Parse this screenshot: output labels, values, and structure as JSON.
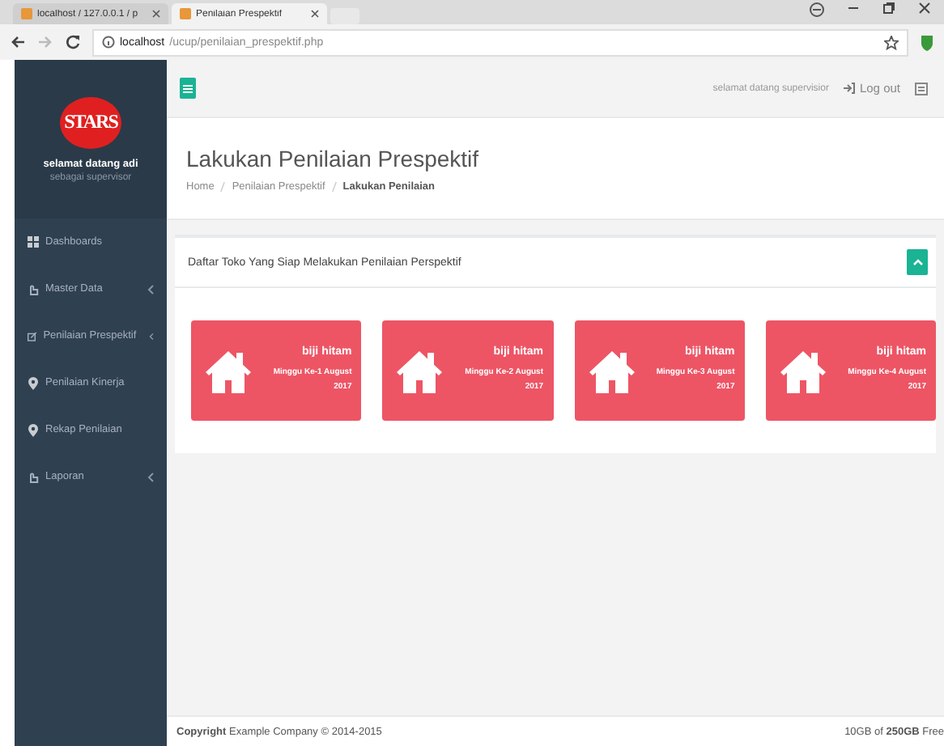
{
  "browser": {
    "tabs": [
      {
        "title": "localhost / 127.0.0.1 / p",
        "selected": false
      },
      {
        "title": "Penilaian Prespektif",
        "selected": true
      }
    ],
    "address": {
      "host": "localhost",
      "path": "/ucup/penilaian_prespektif.php"
    }
  },
  "sidebar": {
    "logo": "STARS",
    "welcome": "selamat datang adi",
    "role": "sebagai supervisor",
    "items": [
      {
        "label": "Dashboards",
        "kind": "grid",
        "has_submenu": false
      },
      {
        "label": "Master Data",
        "kind": "hand",
        "has_submenu": true
      },
      {
        "label": "Penilaian Prespektif",
        "kind": "edit",
        "has_submenu": true
      },
      {
        "label": "Penilaian Kinerja",
        "kind": "pin",
        "has_submenu": false
      },
      {
        "label": "Rekap Penilaian",
        "kind": "pin",
        "has_submenu": false
      },
      {
        "label": "Laporan",
        "kind": "hand",
        "has_submenu": true
      }
    ]
  },
  "topbar": {
    "greeting": "selamat datang supervisior",
    "logout": "Log out"
  },
  "heading": {
    "title": "Lakukan Penilaian Prespektif",
    "breadcrumbs": [
      {
        "label": "Home",
        "current": false
      },
      {
        "label": "Penilaian Prespektif",
        "current": false
      },
      {
        "label": "Lakukan Penilaian",
        "current": true
      }
    ]
  },
  "panel": {
    "title": "Daftar Toko Yang Siap Melakukan Penilaian Perspektif",
    "cards": [
      {
        "name": "biji hitam",
        "period": "Minggu Ke-1 August",
        "year": "2017"
      },
      {
        "name": "biji hitam",
        "period": "Minggu Ke-2 August",
        "year": "2017"
      },
      {
        "name": "biji hitam",
        "period": "Minggu Ke-3 August",
        "year": "2017"
      },
      {
        "name": "biji hitam",
        "period": "Minggu Ke-4 August",
        "year": "2017"
      }
    ]
  },
  "footer": {
    "copyright": "**Copyright** Example Company © 2014-2015",
    "storage": "10GB of **250GB** Free"
  }
}
